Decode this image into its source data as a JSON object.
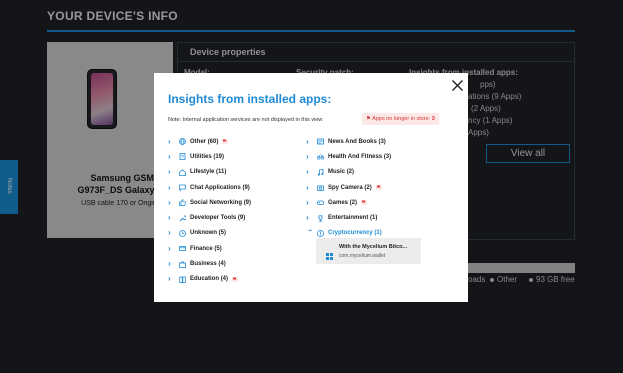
{
  "page": {
    "title": "YOUR DEVICE'S INFO"
  },
  "device": {
    "name": "Samsung GSM SM-G973F_DS Galaxy S10",
    "cable": "USB cable 170 or Original Ca"
  },
  "properties": {
    "title": "Device properties",
    "model_label": "Model:",
    "security_label": "Security patch:",
    "insights_label": "Insights from installed apps:",
    "insights_partial": [
      "pps)",
      "ations (9 Apps)",
      "(2 Apps)",
      "ncy (1 Apps)",
      "Apps)"
    ],
    "view_all": "View all"
  },
  "storage_legend": {
    "items": [
      "oads",
      "Other",
      "93 GB free"
    ]
  },
  "notes_tab": "Notes",
  "modal": {
    "title": "Insights from installed apps:",
    "note": "Note: Internal application services are not displayed in this view",
    "store_badge_label": "Apps no longer in store:",
    "store_badge_count": "3",
    "left_categories": [
      {
        "label": "Other",
        "count": "(60)",
        "icon": "globe-icon",
        "flag": true
      },
      {
        "label": "Utilities",
        "count": "(19)",
        "icon": "clipboard-icon",
        "flag": false
      },
      {
        "label": "Lifestyle",
        "count": "(11)",
        "icon": "home-icon",
        "flag": false
      },
      {
        "label": "Chat Applications",
        "count": "(9)",
        "icon": "chat-icon",
        "flag": false
      },
      {
        "label": "Social Networking",
        "count": "(9)",
        "icon": "thumbs-up-icon",
        "flag": false
      },
      {
        "label": "Developer Tools",
        "count": "(9)",
        "icon": "wrench-icon",
        "flag": false
      },
      {
        "label": "Unknown",
        "count": "(5)",
        "icon": "clock-icon",
        "flag": false
      },
      {
        "label": "Finance",
        "count": "(5)",
        "icon": "card-icon",
        "flag": false
      },
      {
        "label": "Business",
        "count": "(4)",
        "icon": "briefcase-icon",
        "flag": false
      },
      {
        "label": "Education",
        "count": "(4)",
        "icon": "book-icon",
        "flag": true
      }
    ],
    "right_categories": [
      {
        "label": "News And Books",
        "count": "(3)",
        "icon": "newspaper-icon",
        "flag": false
      },
      {
        "label": "Health And Fitness",
        "count": "(3)",
        "icon": "bike-icon",
        "flag": false
      },
      {
        "label": "Music",
        "count": "(2)",
        "icon": "music-icon",
        "flag": false
      },
      {
        "label": "Spy Camera",
        "count": "(2)",
        "icon": "camera-icon",
        "flag": true
      },
      {
        "label": "Games",
        "count": "(2)",
        "icon": "gamepad-icon",
        "flag": true
      },
      {
        "label": "Entertainment",
        "count": "(1)",
        "icon": "trophy-icon",
        "flag": false
      },
      {
        "label": "Cryptocurrency",
        "count": "(1)",
        "icon": "coin-icon",
        "flag": false,
        "expanded": true
      }
    ],
    "expanded_app": {
      "name": "With the Mycelium Bitco...",
      "package": "com.mycelium.wallet"
    }
  },
  "colors": {
    "accent": "#1e8ad6",
    "flag_red": "#e23b3b",
    "badge_bg": "#fde8e8"
  }
}
